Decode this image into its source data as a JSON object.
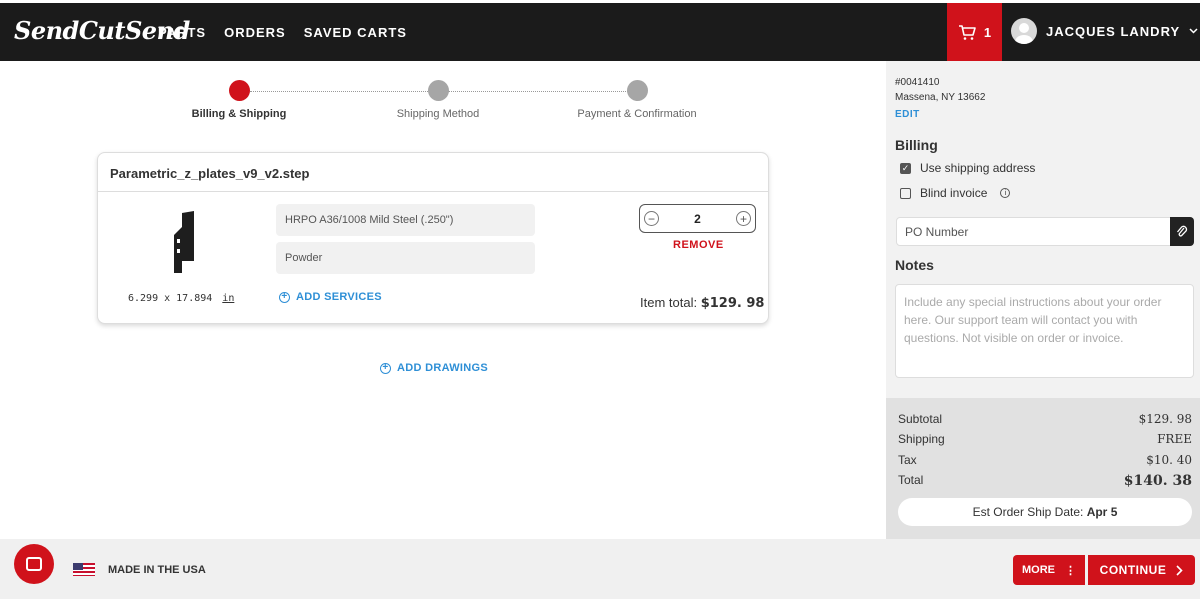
{
  "header": {
    "logo": "SendCutSend",
    "nav": [
      "PARTS",
      "ORDERS",
      "SAVED CARTS"
    ],
    "cart_count": "1",
    "user_name": "JACQUES LANDRY"
  },
  "stepper": {
    "steps": [
      {
        "label": "Billing & Shipping",
        "active": true
      },
      {
        "label": "Shipping Method",
        "active": false
      },
      {
        "label": "Payment & Confirmation",
        "active": false
      }
    ]
  },
  "part": {
    "filename": "Parametric_z_plates_v9_v2.step",
    "dims": "6.299 x 17.894",
    "unit": "in",
    "material": "HRPO A36/1008 Mild Steel (.250\")",
    "finish": "Powder",
    "add_services": "ADD SERVICES",
    "quantity": "2",
    "remove": "REMOVE",
    "item_total_label": "Item total:",
    "item_total_value": "$129. 98"
  },
  "add_drawings": "ADD DRAWINGS",
  "panel": {
    "address_line1": "#0041410",
    "address_line2": "Massena, NY 13662",
    "edit": "EDIT",
    "billing_title": "Billing",
    "use_shipping": "Use shipping address",
    "blind_invoice": "Blind invoice",
    "po_placeholder": "PO Number",
    "notes_title": "Notes",
    "notes_placeholder": "Include any special instructions about your order here. Our support team will contact you with questions. Not visible on order or invoice.",
    "summary": [
      {
        "label": "Subtotal",
        "value": "$129. 98"
      },
      {
        "label": "Shipping",
        "value": "FREE"
      },
      {
        "label": "Tax",
        "value": "$10. 40"
      },
      {
        "label": "Total",
        "value": "$140. 38"
      }
    ],
    "est_label": "Est Order Ship Date:",
    "est_value": "Apr 5"
  },
  "footer": {
    "made_in": "MADE IN THE USA",
    "more": "MORE",
    "continue": "CONTINUE"
  },
  "colors": {
    "brand_red": "#d0121b",
    "link_blue": "#2e8fd6",
    "header_bg": "#1b1b1b"
  }
}
